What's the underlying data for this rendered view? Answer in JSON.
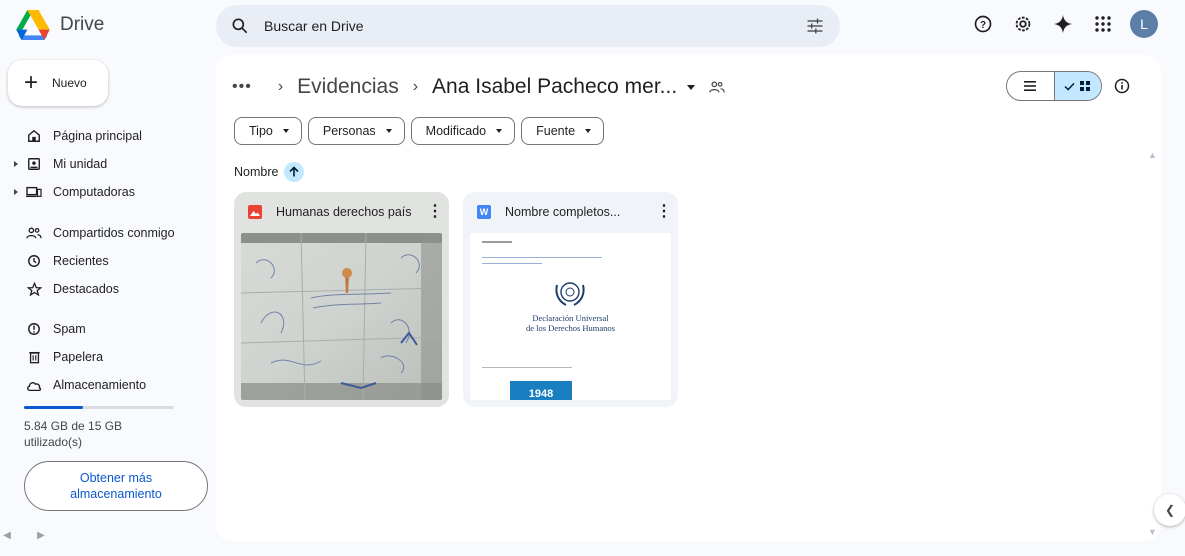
{
  "app": {
    "name": "Drive"
  },
  "search": {
    "placeholder": "Buscar en Drive"
  },
  "header": {
    "avatar_initial": "L"
  },
  "new_button": {
    "label": "Nuevo"
  },
  "sidebar": {
    "items": [
      {
        "label": "Página principal",
        "icon": "home-icon"
      },
      {
        "label": "Mi unidad",
        "icon": "my-drive-icon"
      },
      {
        "label": "Computadoras",
        "icon": "computers-icon"
      },
      {
        "label": "Compartidos conmigo",
        "icon": "shared-icon"
      },
      {
        "label": "Recientes",
        "icon": "clock-icon"
      },
      {
        "label": "Destacados",
        "icon": "star-icon"
      },
      {
        "label": "Spam",
        "icon": "spam-icon"
      },
      {
        "label": "Papelera",
        "icon": "trash-icon"
      },
      {
        "label": "Almacenamiento",
        "icon": "cloud-icon"
      }
    ]
  },
  "storage": {
    "used_text": "5.84 GB de 15 GB utilizado(s)",
    "fraction": 0.39,
    "button_label": "Obtener más almacenamiento"
  },
  "breadcrumb": {
    "parent": "Evidencias",
    "current": "Ana Isabel Pacheco mer..."
  },
  "filters": [
    "Tipo",
    "Personas",
    "Modificado",
    "Fuente"
  ],
  "sort": {
    "label": "Nombre"
  },
  "files": [
    {
      "name": "Humanas derechos país",
      "type": "image",
      "type_color": "#ea4335"
    },
    {
      "name": "Nombre completos...",
      "type": "word",
      "type_color": "#4285f4"
    }
  ],
  "doc_preview": {
    "title_line1": "Declaración Universal",
    "title_line2": "de los Derechos Humanos",
    "badge": "1948"
  },
  "colors": {
    "accent": "#0b57d0",
    "selected": "#c2e7ff"
  }
}
